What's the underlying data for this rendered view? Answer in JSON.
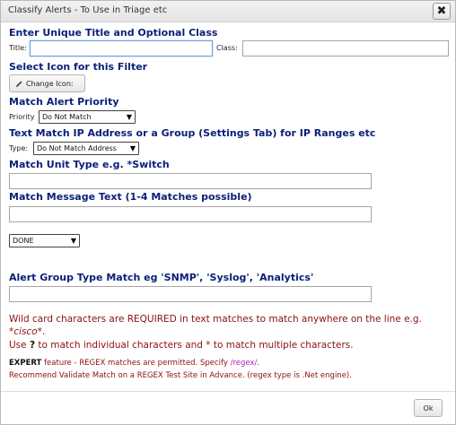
{
  "dialog": {
    "title": "Classify Alerts - To Use in Triage etc",
    "close_glyph": "✖"
  },
  "title_section": {
    "heading": "Enter Unique Title and Optional Class",
    "title_label": "Title:",
    "title_value": "",
    "class_label": "Class:",
    "class_value": ""
  },
  "icon_section": {
    "heading": "Select Icon for this Filter",
    "button_label": "Change Icon:",
    "button_icon": "pencil-icon"
  },
  "priority_section": {
    "heading": "Match Alert Priority",
    "label": "Priority",
    "selected": "Do Not Match"
  },
  "ip_section": {
    "heading": "Text Match IP Address or a Group (Settings Tab) for IP Ranges etc",
    "label": "Type:",
    "selected": "Do Not Match Address"
  },
  "unit_section": {
    "heading": "Match Unit Type e.g. *Switch",
    "value": ""
  },
  "message_section": {
    "heading": "Match Message Text (1-4 Matches possible)",
    "value": "",
    "done_selected": "DONE"
  },
  "group_section": {
    "heading": "Alert Group Type Match eg 'SNMP', 'Syslog', 'Analytics'",
    "value": ""
  },
  "notes": {
    "wildcard_line1": "Wild card characters are REQUIRED in text matches to match anywhere on the line e.g.",
    "wildcard_example": "*cisco*",
    "wildcard_period": ".",
    "use_prefix": "Use",
    "question_mark": "?",
    "use_suffix": "to match individual characters and * to match multiple characters.",
    "expert_bold": "EXPERT",
    "expert_text": "feature - REGEX matches are permitted. Specify",
    "regex_example": "/regex/",
    "expert_period": ".",
    "recommend": "Recommend Validate Match on a REGEX Test Site in Advance. (regex type is .Net engine)."
  },
  "footer": {
    "ok_label": "Ok"
  }
}
